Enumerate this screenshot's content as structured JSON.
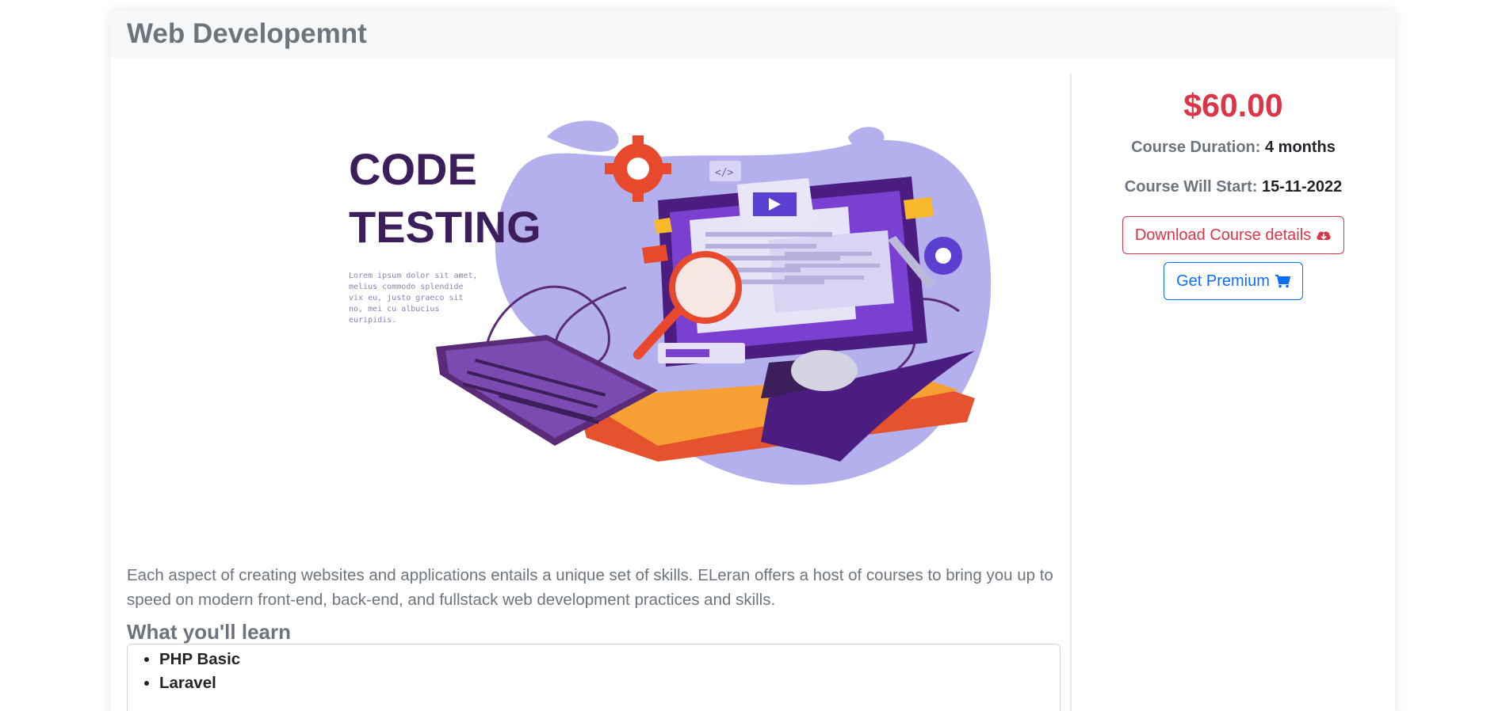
{
  "course": {
    "title": "Web Developemnt",
    "price": "$60.00",
    "duration_label": "Course Duration:",
    "duration_value": "4 months",
    "start_label": "Course Will Start:",
    "start_value": "15-11-2022",
    "download_button": "Download Course details",
    "premium_button": "Get Premium",
    "description": "Each aspect of creating websites and applications entails a unique set of skills. ELeran offers a host of courses to bring you up to speed on modern front-end, back-end, and fullstack web development practices and skills.",
    "learn_title": "What you'll learn",
    "learn_items": [
      "PHP Basic",
      "Laravel"
    ]
  },
  "hero_image": {
    "heading_line1": "CODE",
    "heading_line2": "TESTING",
    "lorem": [
      "Lorem ipsum dolor sit amet,",
      "melius commodo splendide",
      "vix eu, justo graeco sit",
      "no, mei cu albucius",
      "euripidis."
    ]
  },
  "colors": {
    "price": "#dc3545",
    "primary": "#0d6efd",
    "muted": "#6c757d",
    "header_bg": "#f7f8f9"
  },
  "icons": {
    "download": "cloud-download-icon",
    "cart": "cart-icon"
  }
}
